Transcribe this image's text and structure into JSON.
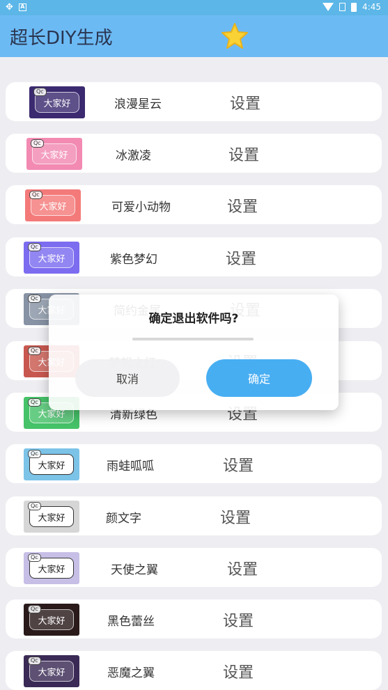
{
  "status_bar": {
    "left_icon_1": "bug-notification-icon",
    "left_icon_2": "a-notification-icon",
    "time": "4:45"
  },
  "app_bar": {
    "title": "超长DIY生成",
    "star_icon": "star-icon"
  },
  "items": [
    {
      "name": "浪漫星云",
      "action": "设置",
      "preview": "大家好",
      "color": "#3b2a70"
    },
    {
      "name": "冰激凌",
      "action": "设置",
      "preview": "大家好",
      "color": "#f28ab2"
    },
    {
      "name": "可爱小动物",
      "action": "设置",
      "preview": "大家好",
      "color": "#f47a7a"
    },
    {
      "name": "紫色梦幻",
      "action": "设置",
      "preview": "大家好",
      "color": "#7b6cf0"
    },
    {
      "name": "简约金属",
      "action": "设置",
      "preview": "大家好",
      "color": "#8793a4"
    },
    {
      "name": "梦想之红",
      "action": "设置",
      "preview": "大家好",
      "color": "#c8584f"
    },
    {
      "name": "清新绿色",
      "action": "设置",
      "preview": "大家好",
      "color": "#46c269"
    },
    {
      "name": "雨蛙呱呱",
      "action": "设置",
      "preview": "大家好",
      "color": "#7cc3e8"
    },
    {
      "name": "颜文字",
      "action": "设置",
      "preview": "大家好",
      "color": "#d6d6d6"
    },
    {
      "name": "天使之翼",
      "action": "设置",
      "preview": "大家好",
      "color": "#c7bfe6"
    },
    {
      "name": "黑色蕾丝",
      "action": "设置",
      "preview": "大家好",
      "color": "#2a1a1a"
    },
    {
      "name": "恶魔之翼",
      "action": "设置",
      "preview": "大家好",
      "color": "#3a2a55"
    }
  ],
  "dialog": {
    "message": "确定退出软件吗?",
    "cancel_label": "取消",
    "confirm_label": "确定",
    "confirm_color": "#48aef2"
  }
}
